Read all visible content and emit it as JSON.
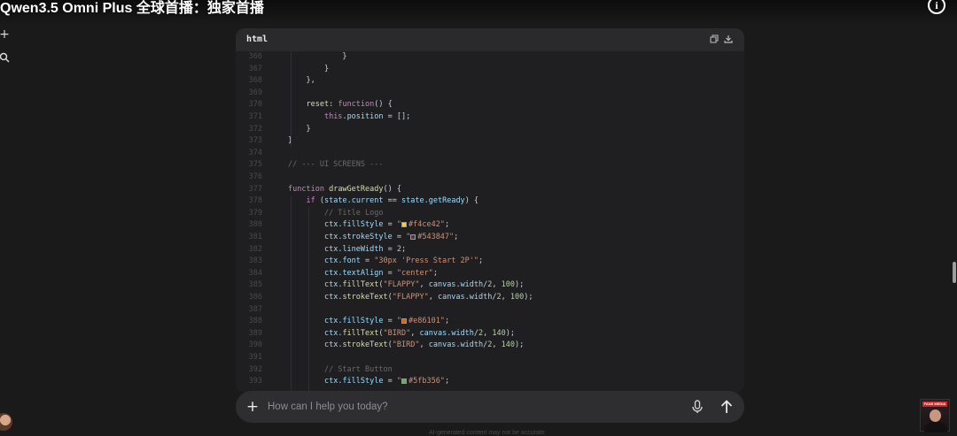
{
  "video": {
    "title": "Qwen3.5 Omni Plus 全球首播：独家首播"
  },
  "icons": {
    "info": "info-icon",
    "new_chat": "plus-icon",
    "search": "search-icon",
    "copy": "copy-icon",
    "download": "download-icon",
    "scroll_down": "arrow-down-icon",
    "attach": "plus-icon",
    "mic": "microphone-icon",
    "send": "arrow-up-icon"
  },
  "code_block": {
    "language": "html",
    "lines": [
      {
        "num": "366",
        "html": "            }"
      },
      {
        "num": "367",
        "html": "        }"
      },
      {
        "num": "368",
        "html": "    },"
      },
      {
        "num": "369",
        "html": ""
      },
      {
        "num": "370",
        "html": "    <span class='fn'>reset</span>: <span class='k'>function</span>() {"
      },
      {
        "num": "371",
        "html": "        <span class='k'>this</span>.<span class='v'>position</span> = [];"
      },
      {
        "num": "372",
        "html": "    }"
      },
      {
        "num": "373",
        "html": "}"
      },
      {
        "num": "374",
        "html": ""
      },
      {
        "num": "375",
        "html": "<span class='c'>// --- UI SCREENS ---</span>"
      },
      {
        "num": "376",
        "html": ""
      },
      {
        "num": "377",
        "html": "<span class='k'>function</span> <span class='fn'>drawGetReady</span>() {"
      },
      {
        "num": "378",
        "html": "    <span class='k'>if</span> (<span class='v'>state</span>.<span class='v'>current</span> == <span class='v'>state</span>.<span class='v'>getReady</span>) {"
      },
      {
        "num": "379",
        "html": "        <span class='c'>// Title Logo</span>"
      },
      {
        "num": "380",
        "html": "        <span class='v'>ctx</span>.<span class='v'>fillStyle</span> = <span class='s'>\"</span><span class='sw' style='background:#f4ce42'></span><span class='s'>#f4ce42\"</span>;"
      },
      {
        "num": "381",
        "html": "        <span class='v'>ctx</span>.<span class='v'>strokeStyle</span> = <span class='s'>\"</span><span class='sw' style='background:#543847'></span><span class='s'>#543847\"</span>;"
      },
      {
        "num": "382",
        "html": "        <span class='v'>ctx</span>.<span class='v'>lineWidth</span> = <span class='n'>2</span>;"
      },
      {
        "num": "383",
        "html": "        <span class='v'>ctx</span>.<span class='v'>font</span> = <span class='s'>\"30px 'Press Start 2P'\"</span>;"
      },
      {
        "num": "384",
        "html": "        <span class='v'>ctx</span>.<span class='v'>textAlign</span> = <span class='s'>\"center\"</span>;"
      },
      {
        "num": "385",
        "html": "        <span class='v'>ctx</span>.<span class='fn'>fillText</span>(<span class='s'>\"FLAPPY\"</span>, <span class='v'>canvas</span>.<span class='v'>width</span>/<span class='n'>2</span>, <span class='n'>100</span>);"
      },
      {
        "num": "386",
        "html": "        <span class='v'>ctx</span>.<span class='fn'>strokeText</span>(<span class='s'>\"FLAPPY\"</span>, <span class='v'>canvas</span>.<span class='v'>width</span>/<span class='n'>2</span>, <span class='n'>100</span>);"
      },
      {
        "num": "387",
        "html": ""
      },
      {
        "num": "388",
        "html": "        <span class='v'>ctx</span>.<span class='v'>fillStyle</span> = <span class='s'>\"</span><span class='sw' style='background:#e86101'></span><span class='s'>#e86101\"</span>;"
      },
      {
        "num": "389",
        "html": "        <span class='v'>ctx</span>.<span class='fn'>fillText</span>(<span class='s'>\"BIRD\"</span>, <span class='v'>canvas</span>.<span class='v'>width</span>/<span class='n'>2</span>, <span class='n'>140</span>);"
      },
      {
        "num": "390",
        "html": "        <span class='v'>ctx</span>.<span class='fn'>strokeText</span>(<span class='s'>\"BIRD\"</span>, <span class='v'>canvas</span>.<span class='v'>width</span>/<span class='n'>2</span>, <span class='n'>140</span>);"
      },
      {
        "num": "391",
        "html": ""
      },
      {
        "num": "392",
        "html": "        <span class='c'>// Start Button</span>"
      },
      {
        "num": "393",
        "html": "        <span class='v'>ctx</span>.<span class='v'>fillStyle</span> = <span class='s'>\"</span><span class='sw' style='background:#5fb356'></span><span class='s'>#5fb356\"</span>;"
      }
    ]
  },
  "chat": {
    "placeholder": "How can I help you today?",
    "disclaimer": "AI-generated content may not be accurate"
  },
  "webcam": {
    "badge": "FANS MEDIA"
  }
}
